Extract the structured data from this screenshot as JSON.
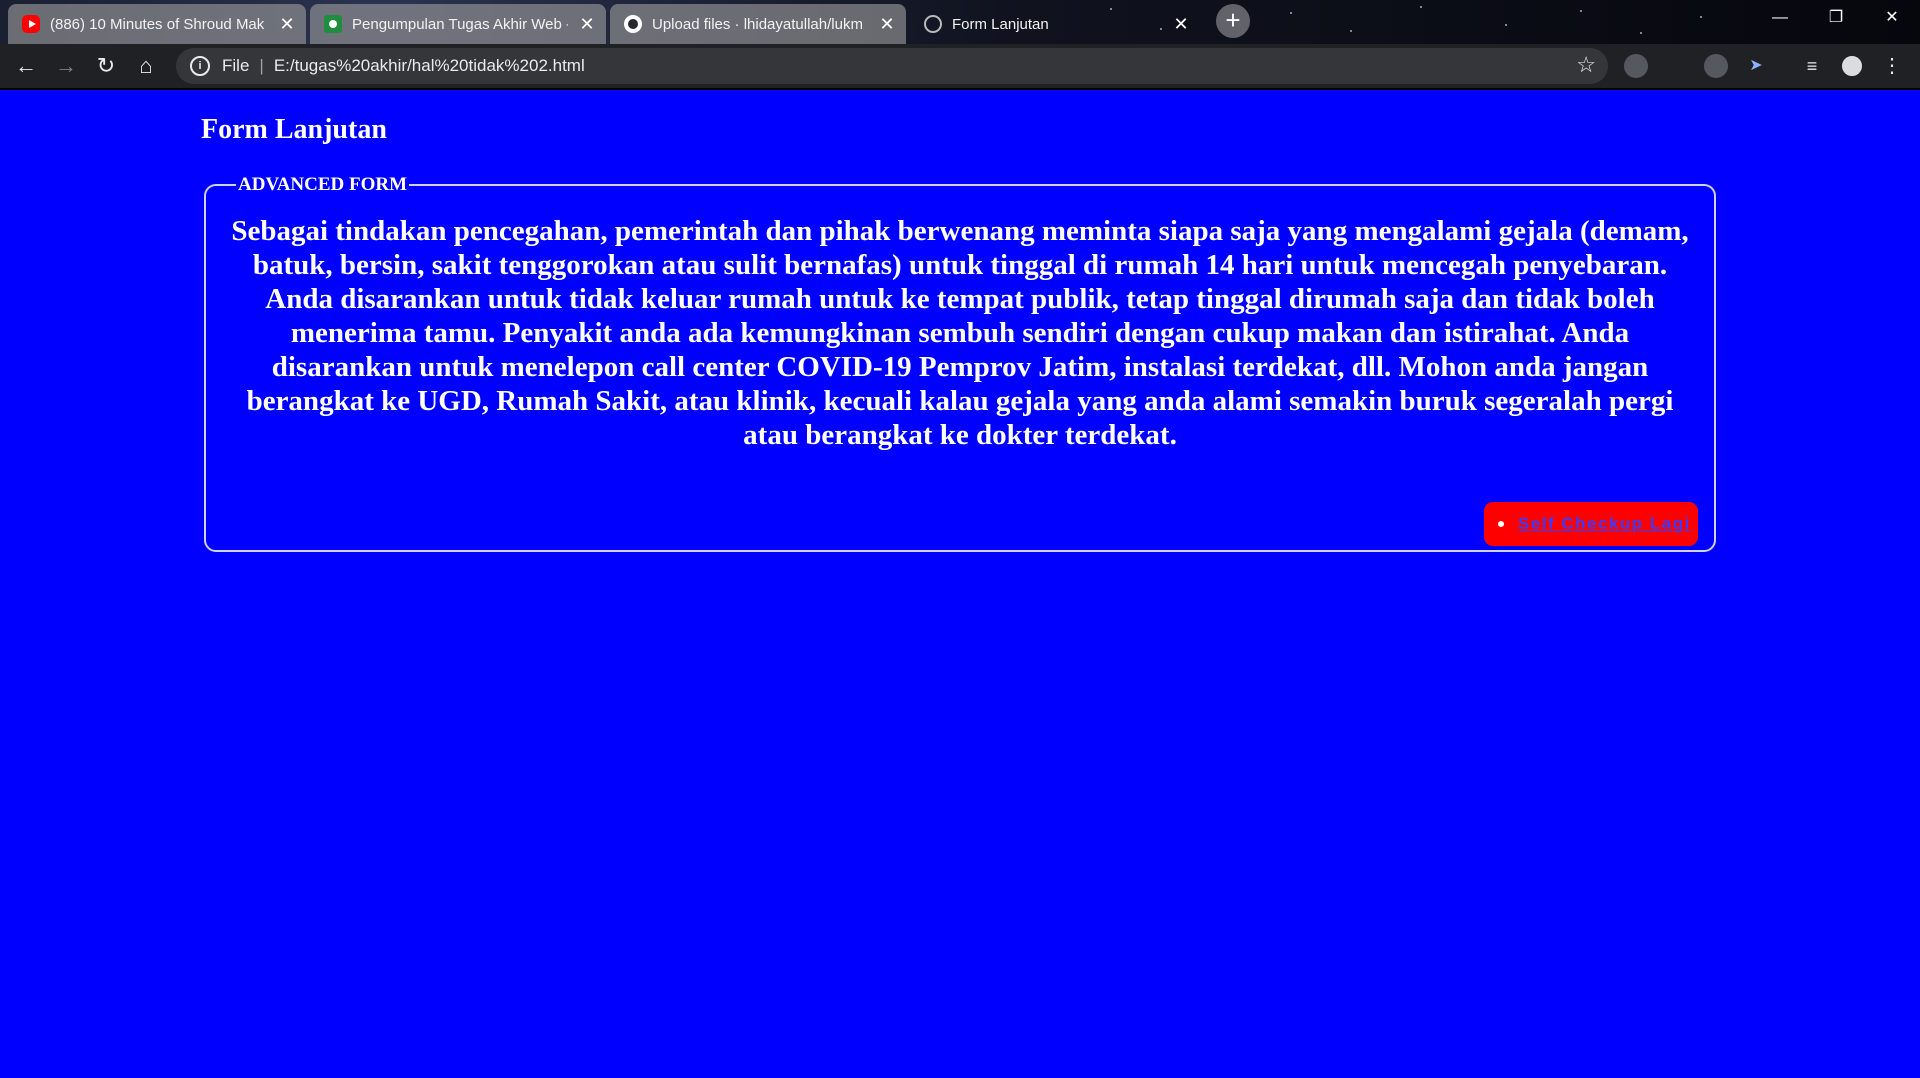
{
  "browser": {
    "tabs": [
      {
        "title": "(886) 10 Minutes of Shroud Mak",
        "icon": "youtube-icon",
        "active": false
      },
      {
        "title": "Pengumpulan Tugas Akhir Web -",
        "icon": "classroom-icon",
        "active": false
      },
      {
        "title": "Upload files · lhidayatullah/lukm",
        "icon": "github-icon",
        "active": false
      },
      {
        "title": "Form Lanjutan",
        "icon": "page-icon",
        "active": true
      }
    ],
    "address": {
      "scheme_label": "File",
      "url": "E:/tugas%20akhir/hal%20tidak%202.html"
    }
  },
  "page": {
    "heading": "Form Lanjutan",
    "fieldset_legend": "ADVANCED FORM",
    "advice_text": "Sebagai tindakan pencegahan, pemerintah dan pihak berwenang meminta siapa saja yang mengalami gejala (demam, batuk, bersin, sakit tenggorokan atau sulit bernafas) untuk tinggal di rumah 14 hari untuk mencegah penyebaran. Anda disarankan untuk tidak keluar rumah untuk ke tempat publik, tetap tinggal dirumah saja dan tidak boleh menerima tamu. Penyakit anda ada kemungkinan sembuh sendiri dengan cukup makan dan istirahat. Anda disarankan untuk menelepon call center COVID-19 Pemprov Jatim, instalasi terdekat, dll. Mohon anda jangan berangkat ke UGD, Rumah Sakit, atau klinik, kecuali kalau gejala yang anda alami semakin buruk segeralah pergi atau berangkat ke dokter terdekat.",
    "checkup_link": "Self Checkup Lagi"
  },
  "colors": {
    "page_background": "#0000ff",
    "button_background": "#ff0000",
    "link_color": "#3b3bff",
    "text_color": "#ffffff"
  }
}
